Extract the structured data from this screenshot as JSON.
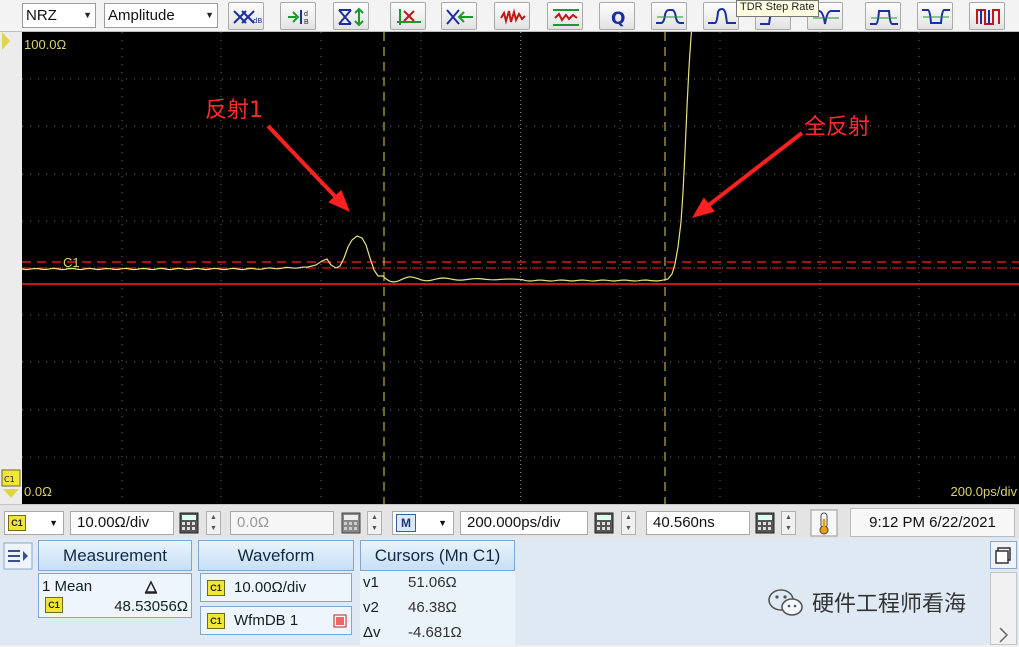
{
  "toolbar": {
    "pattern_select": "NRZ",
    "mode_select": "Amplitude",
    "buttons": [
      "dB-scale",
      "autoscale",
      "marker-arrows",
      "cursor-cross",
      "cursor-delete",
      "noise-filter",
      "ref-waveform",
      "q-factor",
      "wave-1",
      "wave-2",
      "tdr-step-rate",
      "wave-4",
      "wave-5",
      "wave-6",
      "pulse-red"
    ],
    "tooltip": "TDR Step Rate"
  },
  "scope": {
    "top_label": "100.0Ω",
    "bottom_label": "0.0Ω",
    "right_label": "200.0ps/div",
    "channel_marker": "C1",
    "annotation_reflection": "反射1",
    "annotation_total": "全反射",
    "trace_color": "#e8e47a",
    "cursor_color": "#e0d44a",
    "ref_line_color": "#ff2020"
  },
  "controls": {
    "channel": "C1",
    "vertical_scale": "10.00Ω/div",
    "vertical_offset": "0.0Ω",
    "math_select": "M",
    "horizontal_scale": "200.000ps/div",
    "position": "40.560ns",
    "datetime": "9:12 PM 6/22/2021"
  },
  "panel": {
    "measurement_tab": "Measurement",
    "waveform_tab": "Waveform",
    "cursors_tab": "Cursors (Mn C1)",
    "measurement_item": "1 Mean",
    "measurement_value": "48.53056Ω",
    "waveform_scale": "10.00Ω/div",
    "waveform_db": "WfmDB 1",
    "cursor_v1_label": "v1",
    "cursor_v1": "51.06Ω",
    "cursor_v2_label": "v2",
    "cursor_v2": "46.38Ω",
    "cursor_dv_label": "Δv",
    "cursor_dv": "-4.681Ω",
    "channel_tag": "C1"
  },
  "watermark": "硬件工程师看海"
}
